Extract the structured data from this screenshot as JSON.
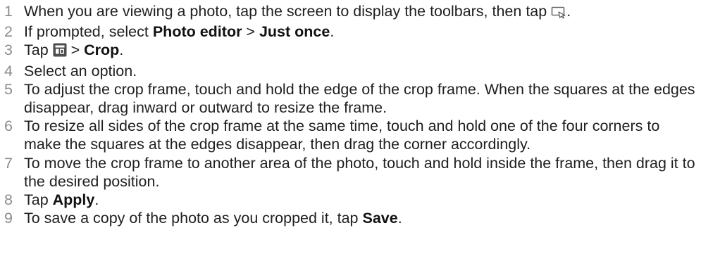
{
  "steps": [
    {
      "number": "1",
      "text_before": "When you are viewing a photo, tap the screen to display the toolbars, then tap ",
      "icon": "edit-photo-icon",
      "text_after": "."
    },
    {
      "number": "2",
      "text_before": "If prompted, select ",
      "bold_1": "Photo editor",
      "text_middle": " > ",
      "bold_2": "Just once",
      "text_after": "."
    },
    {
      "number": "3",
      "text_before": "Tap ",
      "icon": "crop-tools-icon",
      "text_middle": " > ",
      "bold_1": "Crop",
      "text_after": "."
    },
    {
      "number": "4",
      "text": "Select an option."
    },
    {
      "number": "5",
      "text": "To adjust the crop frame, touch and hold the edge of the crop frame. When the squares at the edges disappear, drag inward or outward to resize the frame."
    },
    {
      "number": "6",
      "text": "To resize all sides of the crop frame at the same time, touch and hold one of the four corners to make the squares at the edges disappear, then drag the corner accordingly."
    },
    {
      "number": "7",
      "text": "To move the crop frame to another area of the photo, touch and hold inside the frame, then drag it to the desired position."
    },
    {
      "number": "8",
      "text_before": "Tap ",
      "bold_1": "Apply",
      "text_after": "."
    },
    {
      "number": "9",
      "text_before": "To save a copy of the photo as you cropped it, tap ",
      "bold_1": "Save",
      "text_after": "."
    }
  ]
}
